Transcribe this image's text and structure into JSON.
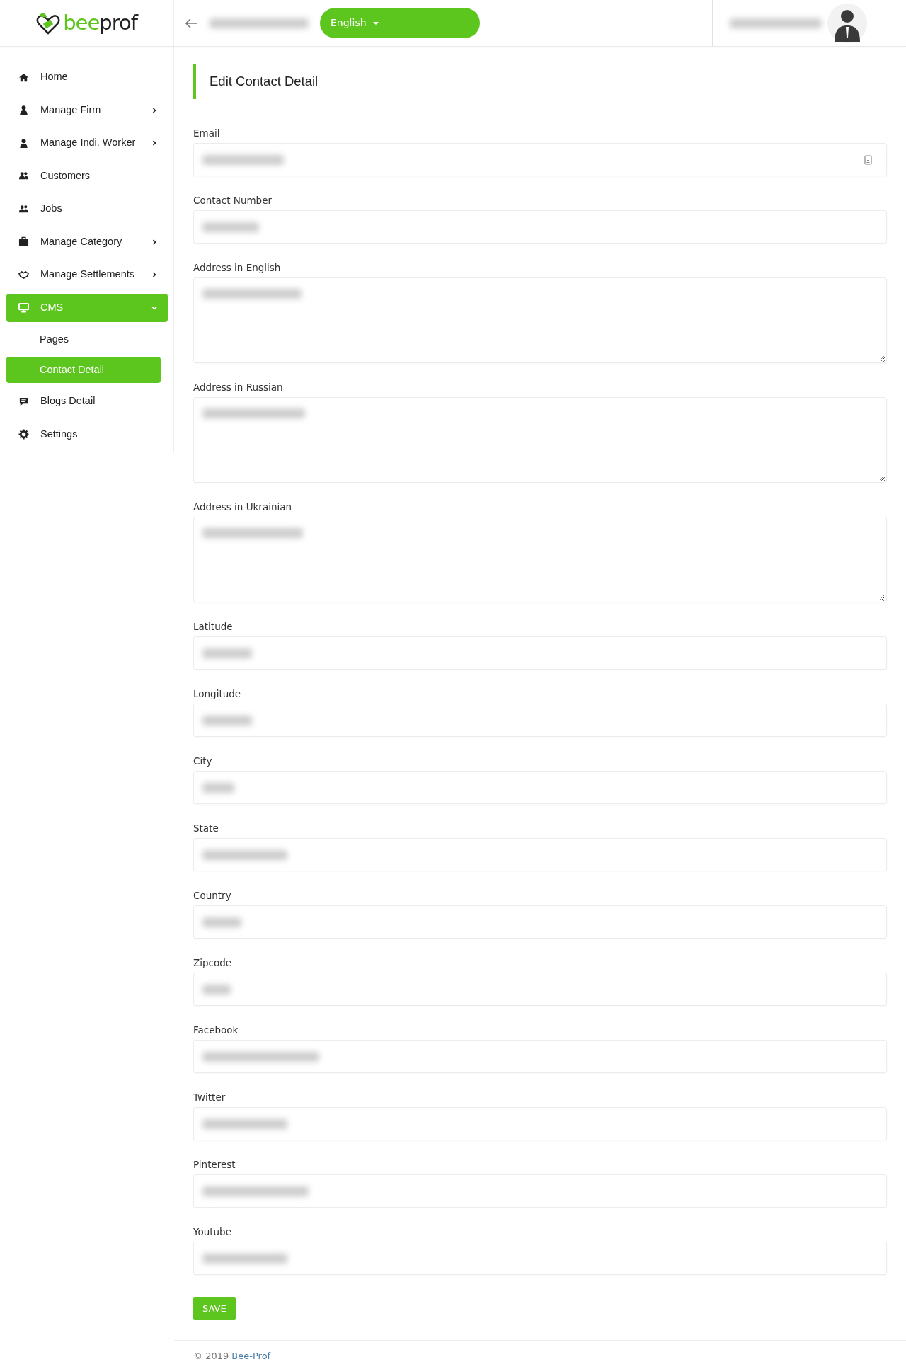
{
  "logo": {
    "accent": "bee",
    "rest": "prof"
  },
  "header": {
    "language": "English"
  },
  "sidebar": {
    "items": [
      {
        "label": "Home",
        "submenu": false,
        "selected": false
      },
      {
        "label": "Manage Firm",
        "submenu": true,
        "selected": false
      },
      {
        "label": "Manage Indi. Worker",
        "submenu": true,
        "selected": false
      },
      {
        "label": "Customers",
        "submenu": false,
        "selected": false
      },
      {
        "label": "Jobs",
        "submenu": false,
        "selected": false
      },
      {
        "label": "Manage Category",
        "submenu": true,
        "selected": false
      },
      {
        "label": "Manage Settlements",
        "submenu": true,
        "selected": false
      },
      {
        "label": "CMS",
        "submenu": true,
        "expanded": true,
        "selected": true,
        "children": [
          {
            "label": "Pages",
            "selected": false
          },
          {
            "label": "Contact Detail",
            "selected": true
          }
        ]
      },
      {
        "label": "Blogs Detail",
        "submenu": false,
        "selected": false
      },
      {
        "label": "Settings",
        "submenu": false,
        "selected": false
      }
    ]
  },
  "form": {
    "title": "Edit Contact Detail",
    "fields": [
      {
        "label": "Email",
        "kind": "input-with-icon"
      },
      {
        "label": "Contact Number",
        "kind": "input"
      },
      {
        "label": "Address in English",
        "kind": "textarea"
      },
      {
        "label": "Address in Russian",
        "kind": "textarea"
      },
      {
        "label": "Address in Ukrainian",
        "kind": "textarea"
      },
      {
        "label": "Latitude",
        "kind": "input"
      },
      {
        "label": "Longitude",
        "kind": "input"
      },
      {
        "label": "City",
        "kind": "input"
      },
      {
        "label": "State",
        "kind": "input"
      },
      {
        "label": "Country",
        "kind": "input"
      },
      {
        "label": "Zipcode",
        "kind": "input"
      },
      {
        "label": "Facebook",
        "kind": "input"
      },
      {
        "label": "Twitter",
        "kind": "input"
      },
      {
        "label": "Pinterest",
        "kind": "input"
      },
      {
        "label": "Youtube",
        "kind": "input"
      }
    ],
    "save_button": "SAVE"
  },
  "footer": {
    "text": "© 2019",
    "link": "Bee-Prof"
  }
}
